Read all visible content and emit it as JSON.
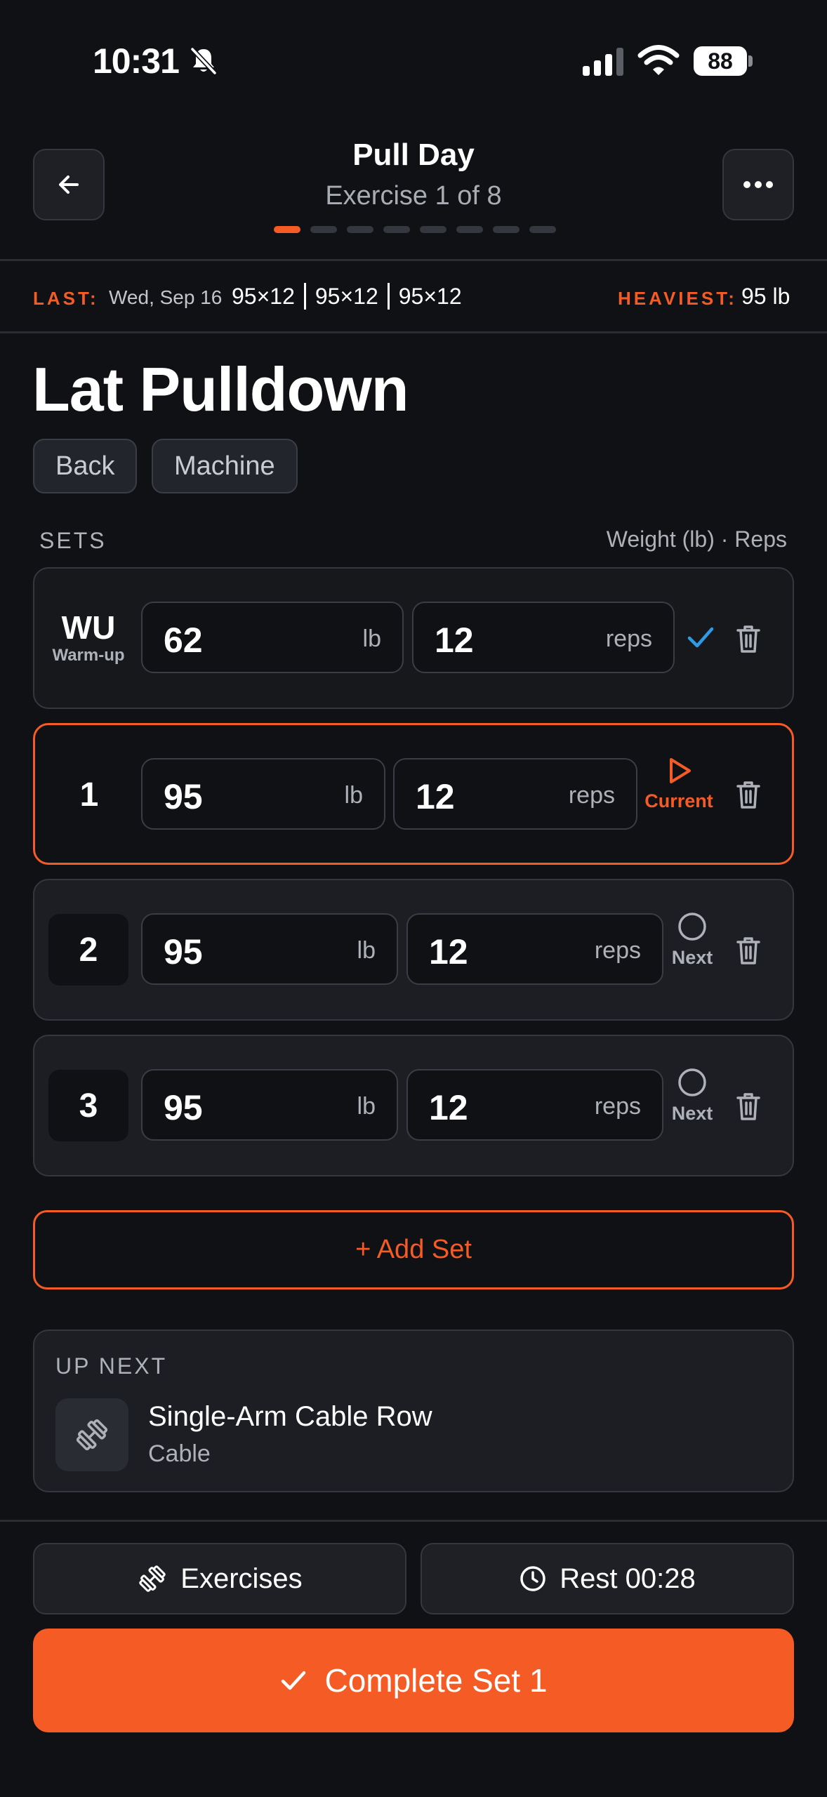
{
  "status_bar": {
    "time": "10:31",
    "battery": "88"
  },
  "header": {
    "title": "Pull Day",
    "subtitle": "Exercise 1 of 8",
    "progress_total": 8,
    "progress_current": 1
  },
  "last": {
    "label": "LAST:",
    "date": "Wed, Sep 16",
    "sets": [
      "95×12",
      "95×12",
      "95×12"
    ],
    "heaviest_label": "HEAVIEST:",
    "heaviest_value": "95 lb"
  },
  "exercise": {
    "name": "Lat Pulldown",
    "tags": [
      "Back",
      "Machine"
    ]
  },
  "sets_section": {
    "label": "SETS",
    "hint": "Weight (lb) · Reps",
    "weight_unit": "lb",
    "reps_unit": "reps",
    "rows": [
      {
        "num": "WU",
        "sub": "Warm-up",
        "weight": "62",
        "reps": "12",
        "status": "done"
      },
      {
        "num": "1",
        "weight": "95",
        "reps": "12",
        "status": "current",
        "status_label": "Current"
      },
      {
        "num": "2",
        "weight": "95",
        "reps": "12",
        "status": "next",
        "status_label": "Next"
      },
      {
        "num": "3",
        "weight": "95",
        "reps": "12",
        "status": "next",
        "status_label": "Next"
      }
    ]
  },
  "add_set_label": "+ Add Set",
  "up_next": {
    "label": "UP NEXT",
    "name": "Single-Arm Cable Row",
    "category": "Cable"
  },
  "bottom": {
    "exercises_label": "Exercises",
    "rest_label": "Rest 00:28",
    "complete_label": "Complete Set 1"
  },
  "colors": {
    "accent": "#f45b25",
    "check": "#2f9be8",
    "background": "#101115",
    "card": "#1c1e23"
  }
}
